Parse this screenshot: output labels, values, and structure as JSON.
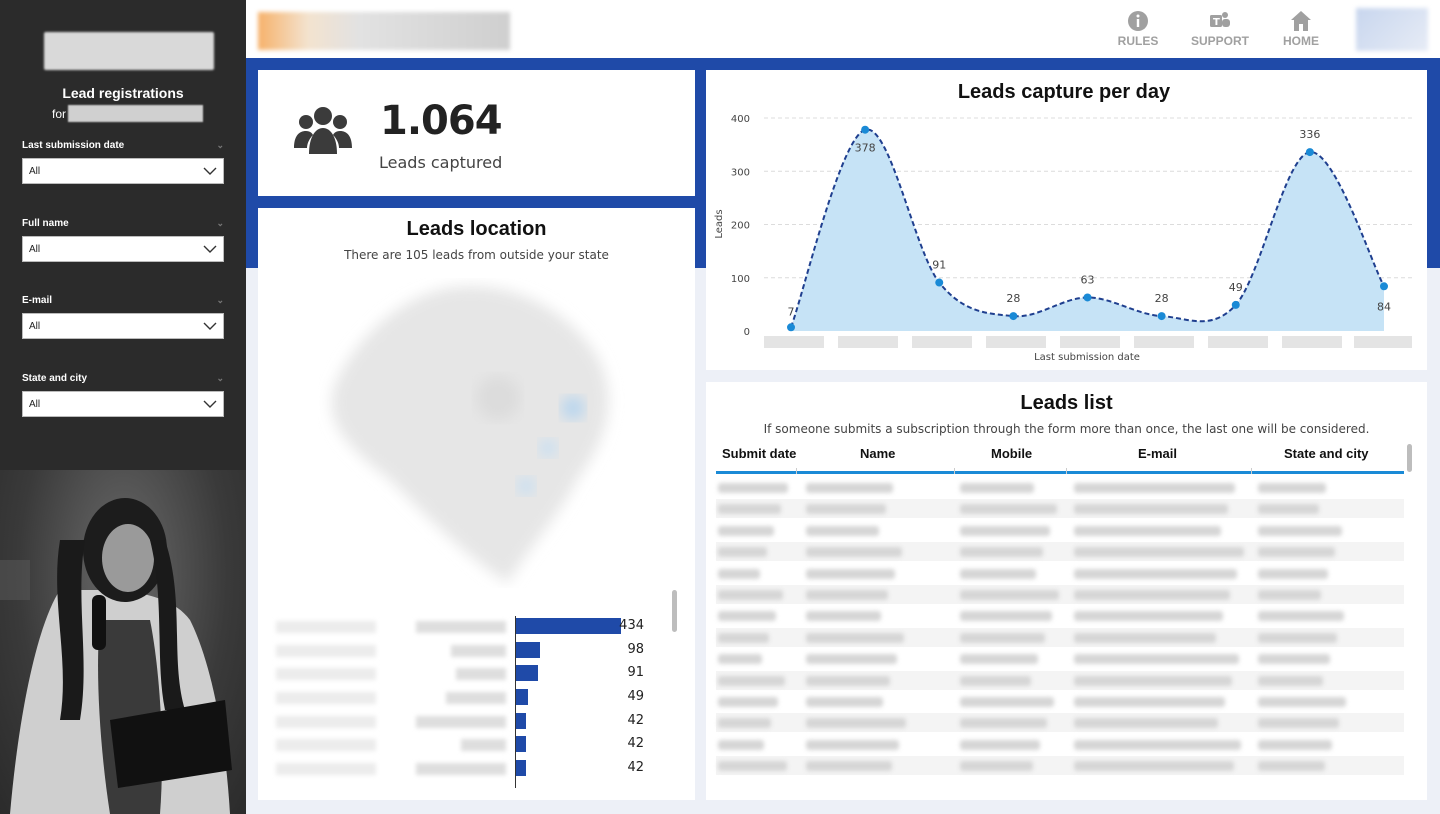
{
  "sidebar": {
    "title": "Lead registrations",
    "for_label": "for",
    "filters": [
      {
        "label": "Last submission date",
        "value": "All"
      },
      {
        "label": "Full name",
        "value": "All"
      },
      {
        "label": "E-mail",
        "value": "All"
      },
      {
        "label": "State and city",
        "value": "All"
      }
    ]
  },
  "header": {
    "nav": [
      {
        "label": "RULES",
        "icon": "info-icon"
      },
      {
        "label": "SUPPORT",
        "icon": "teams-icon"
      },
      {
        "label": "HOME",
        "icon": "home-icon"
      }
    ]
  },
  "kpi": {
    "value": "1.064",
    "label": "Leads captured",
    "icon": "people-icon"
  },
  "location": {
    "title": "Leads location",
    "subtitle": "There are 105 leads from outside your state",
    "bars": [
      434,
      98,
      91,
      49,
      42,
      42,
      42
    ]
  },
  "colors": {
    "accent": "#1f4aa8",
    "area": "#c6e3f6",
    "line": "#1f3f8f",
    "point": "#1a8ad6",
    "list_underline": "#1a8ad6"
  },
  "chart_data": {
    "type": "area",
    "title": "Leads capture per day",
    "xlabel": "Last submission date",
    "ylabel": "Leads",
    "ylim": [
      0,
      400
    ],
    "yticks": [
      0,
      100,
      200,
      300,
      400
    ],
    "series": [
      {
        "values": [
          7,
          378,
          91,
          28,
          63,
          28,
          49,
          336,
          84
        ]
      }
    ],
    "data_labels": [
      "7",
      "378",
      "91",
      "28",
      "63",
      "28",
      "49",
      "336",
      "84"
    ],
    "grid": true
  },
  "leads_list": {
    "title": "Leads list",
    "subtitle": "If someone submits a subscription through the form more than once, the last one will be considered.",
    "columns": [
      "Submit date",
      "Name",
      "Mobile",
      "E-mail",
      "State and city"
    ]
  }
}
